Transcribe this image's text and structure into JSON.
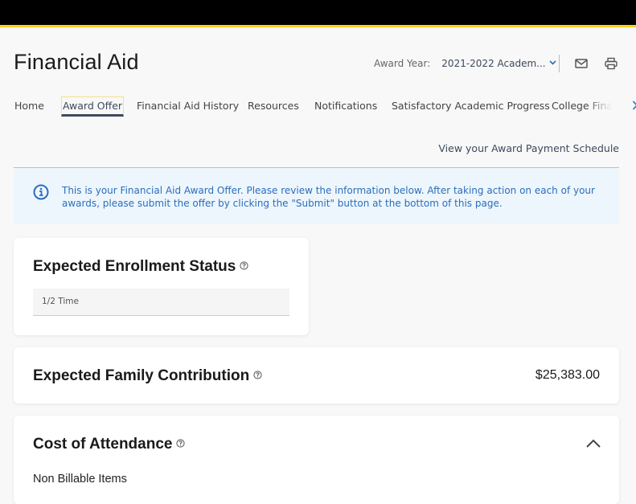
{
  "header": {
    "title": "Financial Aid",
    "award_year_label": "Award Year:",
    "award_year_value": "2021-2022 Academ...",
    "icons": {
      "mail": "mail-icon",
      "print": "print-icon"
    }
  },
  "nav": {
    "items": [
      {
        "label": "Home",
        "active": false
      },
      {
        "label": "Award Offer",
        "active": true
      },
      {
        "label": "Financial Aid History",
        "active": false
      },
      {
        "label": "Resources",
        "active": false
      },
      {
        "label": "Notifications",
        "active": false
      },
      {
        "label": "Satisfactory Academic Progress",
        "active": false
      },
      {
        "label": "College Fina",
        "active": false
      }
    ],
    "next_icon": "chevron-right-icon"
  },
  "payment_schedule_link": "View your Award Payment Schedule",
  "info_banner": {
    "icon": "info-icon",
    "text": "This is your Financial Aid Award Offer. Please review the information below. After taking action on each of your awards, please submit the offer by clicking the \"Submit\" button at the bottom of this page."
  },
  "enrollment": {
    "title": "Expected Enrollment Status",
    "value": "1/2 Time"
  },
  "efc": {
    "title": "Expected Family Contribution",
    "amount": "$25,383.00"
  },
  "cost_of_attendance": {
    "title": "Cost of Attendance",
    "expanded": true,
    "subheading": "Non Billable Items"
  },
  "colors": {
    "accent_yellow": "#fcd116",
    "link_blue": "#2a6ebb",
    "nav_active": "#3d4a5c",
    "banner_bg": "#eef6fd"
  }
}
